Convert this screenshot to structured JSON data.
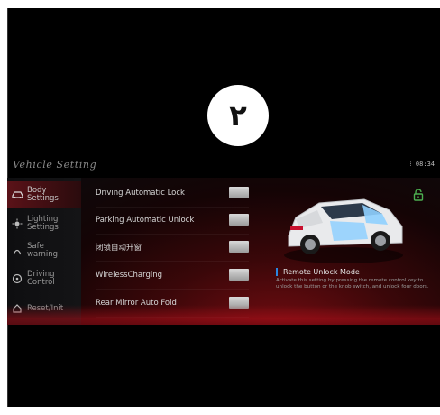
{
  "overlay": {
    "badge_text": "٢"
  },
  "header": {
    "title": "Vehicle Setting",
    "status_time": "08:34"
  },
  "sidebar": {
    "items": [
      {
        "label": "Body\nSettings",
        "icon": "car-body-icon"
      },
      {
        "label": "Lighting\nSettings",
        "icon": "light-icon"
      },
      {
        "label": "Safe\nwarning",
        "icon": "safety-icon"
      },
      {
        "label": "Driving\nControl",
        "icon": "steering-icon"
      },
      {
        "label": "Reset/Init",
        "icon": "reset-icon"
      }
    ]
  },
  "settings": {
    "rows": [
      {
        "label": "Driving Automatic Lock"
      },
      {
        "label": "Parking Automatic Unlock"
      },
      {
        "label": "闭锁自动升窗"
      },
      {
        "label": "WirelessCharging"
      },
      {
        "label": "Rear Mirror Auto Fold"
      }
    ]
  },
  "detail": {
    "title": "Remote Unlock Mode",
    "description": "Activate this setting by pressing the remote control key to unlock the button or the knob switch, and unlock four doors."
  },
  "colors": {
    "accent": "#2a86e0",
    "active_bg": "#5a1218",
    "unlock_icon": "#4caf50"
  }
}
